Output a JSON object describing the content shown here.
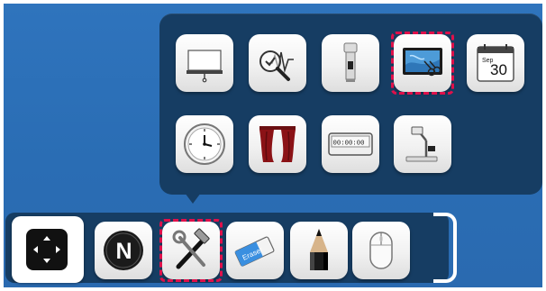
{
  "popup": {
    "row1": [
      {
        "name": "whiteboard-screen-tool",
        "icon": "projector-screen-icon"
      },
      {
        "name": "analyze-zoom-tool",
        "icon": "magnifier-graph-icon"
      },
      {
        "name": "flashlight-tool",
        "icon": "flashlight-icon"
      },
      {
        "name": "screen-capture-tool",
        "icon": "screen-scissors-icon",
        "selected": true
      },
      {
        "name": "calendar-tool",
        "icon": "calendar-icon",
        "month": "Sep",
        "day": "30"
      }
    ],
    "row2": [
      {
        "name": "clock-tool",
        "icon": "clock-icon"
      },
      {
        "name": "curtain-tool",
        "icon": "curtain-icon"
      },
      {
        "name": "counter-tool",
        "icon": "counter-display-icon",
        "digits": "00:00:00"
      },
      {
        "name": "document-camera-tool",
        "icon": "document-camera-icon"
      }
    ]
  },
  "toolbar": {
    "items": [
      {
        "name": "notebook-tool",
        "icon": "n-logo-icon",
        "letter": "N"
      },
      {
        "name": "tools-menu",
        "icon": "wrench-hammer-icon",
        "selected": true
      },
      {
        "name": "eraser-tool",
        "icon": "eraser-icon",
        "label": "Eraser"
      },
      {
        "name": "pen-tool",
        "icon": "pencil-icon"
      },
      {
        "name": "mouse-tool",
        "icon": "mouse-icon"
      }
    ]
  },
  "navpad": {
    "icon": "move-arrows-icon"
  },
  "colors": {
    "background": "#2a6db4",
    "panel": "#163d63",
    "selection": "#e0104a"
  }
}
